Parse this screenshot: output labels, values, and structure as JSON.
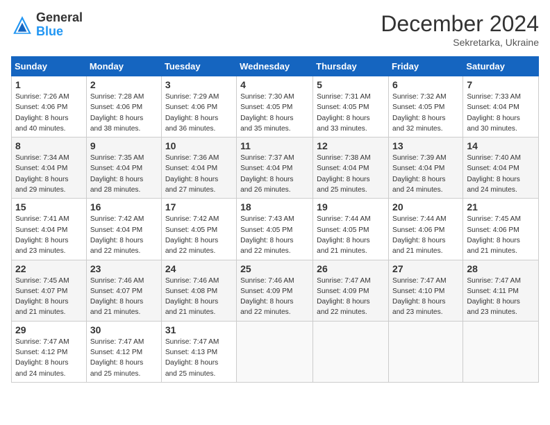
{
  "logo": {
    "general": "General",
    "blue": "Blue"
  },
  "title": "December 2024",
  "location": "Sekretarka, Ukraine",
  "days_of_week": [
    "Sunday",
    "Monday",
    "Tuesday",
    "Wednesday",
    "Thursday",
    "Friday",
    "Saturday"
  ],
  "weeks": [
    [
      {
        "day": "1",
        "info": "Sunrise: 7:26 AM\nSunset: 4:06 PM\nDaylight: 8 hours\nand 40 minutes."
      },
      {
        "day": "2",
        "info": "Sunrise: 7:28 AM\nSunset: 4:06 PM\nDaylight: 8 hours\nand 38 minutes."
      },
      {
        "day": "3",
        "info": "Sunrise: 7:29 AM\nSunset: 4:06 PM\nDaylight: 8 hours\nand 36 minutes."
      },
      {
        "day": "4",
        "info": "Sunrise: 7:30 AM\nSunset: 4:05 PM\nDaylight: 8 hours\nand 35 minutes."
      },
      {
        "day": "5",
        "info": "Sunrise: 7:31 AM\nSunset: 4:05 PM\nDaylight: 8 hours\nand 33 minutes."
      },
      {
        "day": "6",
        "info": "Sunrise: 7:32 AM\nSunset: 4:05 PM\nDaylight: 8 hours\nand 32 minutes."
      },
      {
        "day": "7",
        "info": "Sunrise: 7:33 AM\nSunset: 4:04 PM\nDaylight: 8 hours\nand 30 minutes."
      }
    ],
    [
      {
        "day": "8",
        "info": "Sunrise: 7:34 AM\nSunset: 4:04 PM\nDaylight: 8 hours\nand 29 minutes."
      },
      {
        "day": "9",
        "info": "Sunrise: 7:35 AM\nSunset: 4:04 PM\nDaylight: 8 hours\nand 28 minutes."
      },
      {
        "day": "10",
        "info": "Sunrise: 7:36 AM\nSunset: 4:04 PM\nDaylight: 8 hours\nand 27 minutes."
      },
      {
        "day": "11",
        "info": "Sunrise: 7:37 AM\nSunset: 4:04 PM\nDaylight: 8 hours\nand 26 minutes."
      },
      {
        "day": "12",
        "info": "Sunrise: 7:38 AM\nSunset: 4:04 PM\nDaylight: 8 hours\nand 25 minutes."
      },
      {
        "day": "13",
        "info": "Sunrise: 7:39 AM\nSunset: 4:04 PM\nDaylight: 8 hours\nand 24 minutes."
      },
      {
        "day": "14",
        "info": "Sunrise: 7:40 AM\nSunset: 4:04 PM\nDaylight: 8 hours\nand 24 minutes."
      }
    ],
    [
      {
        "day": "15",
        "info": "Sunrise: 7:41 AM\nSunset: 4:04 PM\nDaylight: 8 hours\nand 23 minutes."
      },
      {
        "day": "16",
        "info": "Sunrise: 7:42 AM\nSunset: 4:04 PM\nDaylight: 8 hours\nand 22 minutes."
      },
      {
        "day": "17",
        "info": "Sunrise: 7:42 AM\nSunset: 4:05 PM\nDaylight: 8 hours\nand 22 minutes."
      },
      {
        "day": "18",
        "info": "Sunrise: 7:43 AM\nSunset: 4:05 PM\nDaylight: 8 hours\nand 22 minutes."
      },
      {
        "day": "19",
        "info": "Sunrise: 7:44 AM\nSunset: 4:05 PM\nDaylight: 8 hours\nand 21 minutes."
      },
      {
        "day": "20",
        "info": "Sunrise: 7:44 AM\nSunset: 4:06 PM\nDaylight: 8 hours\nand 21 minutes."
      },
      {
        "day": "21",
        "info": "Sunrise: 7:45 AM\nSunset: 4:06 PM\nDaylight: 8 hours\nand 21 minutes."
      }
    ],
    [
      {
        "day": "22",
        "info": "Sunrise: 7:45 AM\nSunset: 4:07 PM\nDaylight: 8 hours\nand 21 minutes."
      },
      {
        "day": "23",
        "info": "Sunrise: 7:46 AM\nSunset: 4:07 PM\nDaylight: 8 hours\nand 21 minutes."
      },
      {
        "day": "24",
        "info": "Sunrise: 7:46 AM\nSunset: 4:08 PM\nDaylight: 8 hours\nand 21 minutes."
      },
      {
        "day": "25",
        "info": "Sunrise: 7:46 AM\nSunset: 4:09 PM\nDaylight: 8 hours\nand 22 minutes."
      },
      {
        "day": "26",
        "info": "Sunrise: 7:47 AM\nSunset: 4:09 PM\nDaylight: 8 hours\nand 22 minutes."
      },
      {
        "day": "27",
        "info": "Sunrise: 7:47 AM\nSunset: 4:10 PM\nDaylight: 8 hours\nand 23 minutes."
      },
      {
        "day": "28",
        "info": "Sunrise: 7:47 AM\nSunset: 4:11 PM\nDaylight: 8 hours\nand 23 minutes."
      }
    ],
    [
      {
        "day": "29",
        "info": "Sunrise: 7:47 AM\nSunset: 4:12 PM\nDaylight: 8 hours\nand 24 minutes."
      },
      {
        "day": "30",
        "info": "Sunrise: 7:47 AM\nSunset: 4:12 PM\nDaylight: 8 hours\nand 25 minutes."
      },
      {
        "day": "31",
        "info": "Sunrise: 7:47 AM\nSunset: 4:13 PM\nDaylight: 8 hours\nand 25 minutes."
      },
      null,
      null,
      null,
      null
    ]
  ]
}
